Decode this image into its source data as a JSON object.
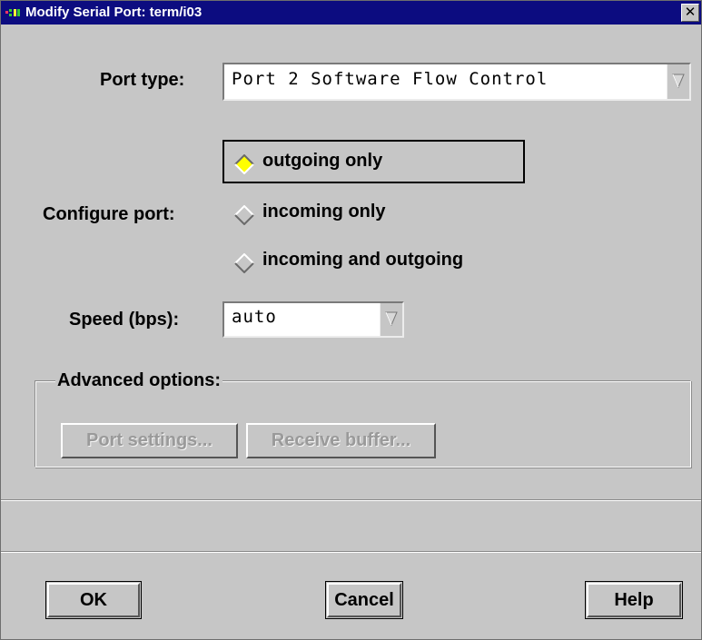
{
  "window": {
    "title": "Modify Serial Port: term/i03",
    "close_glyph": "✕"
  },
  "port_type": {
    "label": "Port type:",
    "value": "Port 2 Software Flow Control"
  },
  "configure_port": {
    "label": "Configure port:",
    "options": [
      {
        "label": "outgoing only",
        "selected": true
      },
      {
        "label": "incoming only",
        "selected": false
      },
      {
        "label": "incoming and outgoing",
        "selected": false
      }
    ]
  },
  "speed": {
    "label": "Speed (bps):",
    "value": "auto"
  },
  "advanced": {
    "title": "Advanced options:",
    "port_settings_label": "Port settings...",
    "receive_buffer_label": "Receive buffer..."
  },
  "footer": {
    "ok_label": "OK",
    "cancel_label": "Cancel",
    "help_label": "Help"
  },
  "colors": {
    "titlebar": "#0c0c80",
    "dialog_bg": "#c6c6c6",
    "radio_selected": "#ffff00",
    "disabled_text": "#9a9a9a"
  },
  "icons": [
    "app-icon",
    "close-icon",
    "dropdown-arrow-icon",
    "radio-diamond-icon"
  ]
}
